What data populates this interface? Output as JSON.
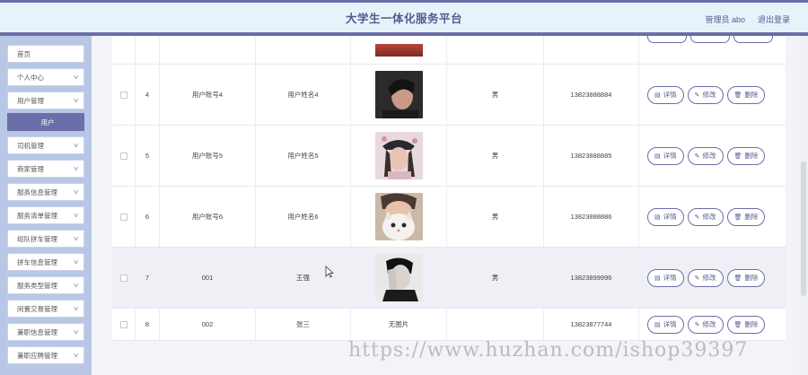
{
  "header": {
    "title": "大学生一体化服务平台",
    "user": "管理员 abo",
    "logout": "退出登录"
  },
  "sidebar": {
    "items": [
      {
        "label": "首页",
        "expandable": false
      },
      {
        "label": "个人中心",
        "expandable": true
      },
      {
        "label": "用户管理",
        "expandable": true
      },
      {
        "label": "用户",
        "sub": true
      },
      {
        "label": "司机管理",
        "expandable": true
      },
      {
        "label": "商家管理",
        "expandable": true
      },
      {
        "label": "服务信息管理",
        "expandable": true
      },
      {
        "label": "服务清单管理",
        "expandable": true
      },
      {
        "label": "组队拼车管理",
        "expandable": true
      },
      {
        "label": "拼车信息管理",
        "expandable": true
      },
      {
        "label": "服务类型管理",
        "expandable": true
      },
      {
        "label": "闲置交易管理",
        "expandable": true
      },
      {
        "label": "兼职信息管理",
        "expandable": true
      },
      {
        "label": "兼职应聘管理",
        "expandable": true
      }
    ]
  },
  "actions": {
    "detail": "详情",
    "edit": "修改",
    "delete": "删除"
  },
  "rows": [
    {
      "no": "4",
      "account": "用户账号4",
      "name": "用户姓名4",
      "photo": "photo-4",
      "gender": "男",
      "phone": "13823888884"
    },
    {
      "no": "5",
      "account": "用户账号5",
      "name": "用户姓名5",
      "photo": "photo-5",
      "gender": "男",
      "phone": "13823888885"
    },
    {
      "no": "6",
      "account": "用户账号6",
      "name": "用户姓名6",
      "photo": "photo-6",
      "gender": "男",
      "phone": "13823888886"
    },
    {
      "no": "7",
      "account": "001",
      "name": "王强",
      "photo": "photo-7",
      "gender": "男",
      "phone": "13823899996"
    },
    {
      "no": "8",
      "account": "002",
      "name": "张三",
      "photo": "",
      "photo_text": "无图片",
      "gender": "",
      "phone": "13823877744"
    }
  ],
  "watermark": "https://www.huzhan.com/ishop39397",
  "colors": {
    "accent": "#6b6ea8",
    "sidebar": "#b9c7e6",
    "header_bg": "#e7f3fb"
  }
}
